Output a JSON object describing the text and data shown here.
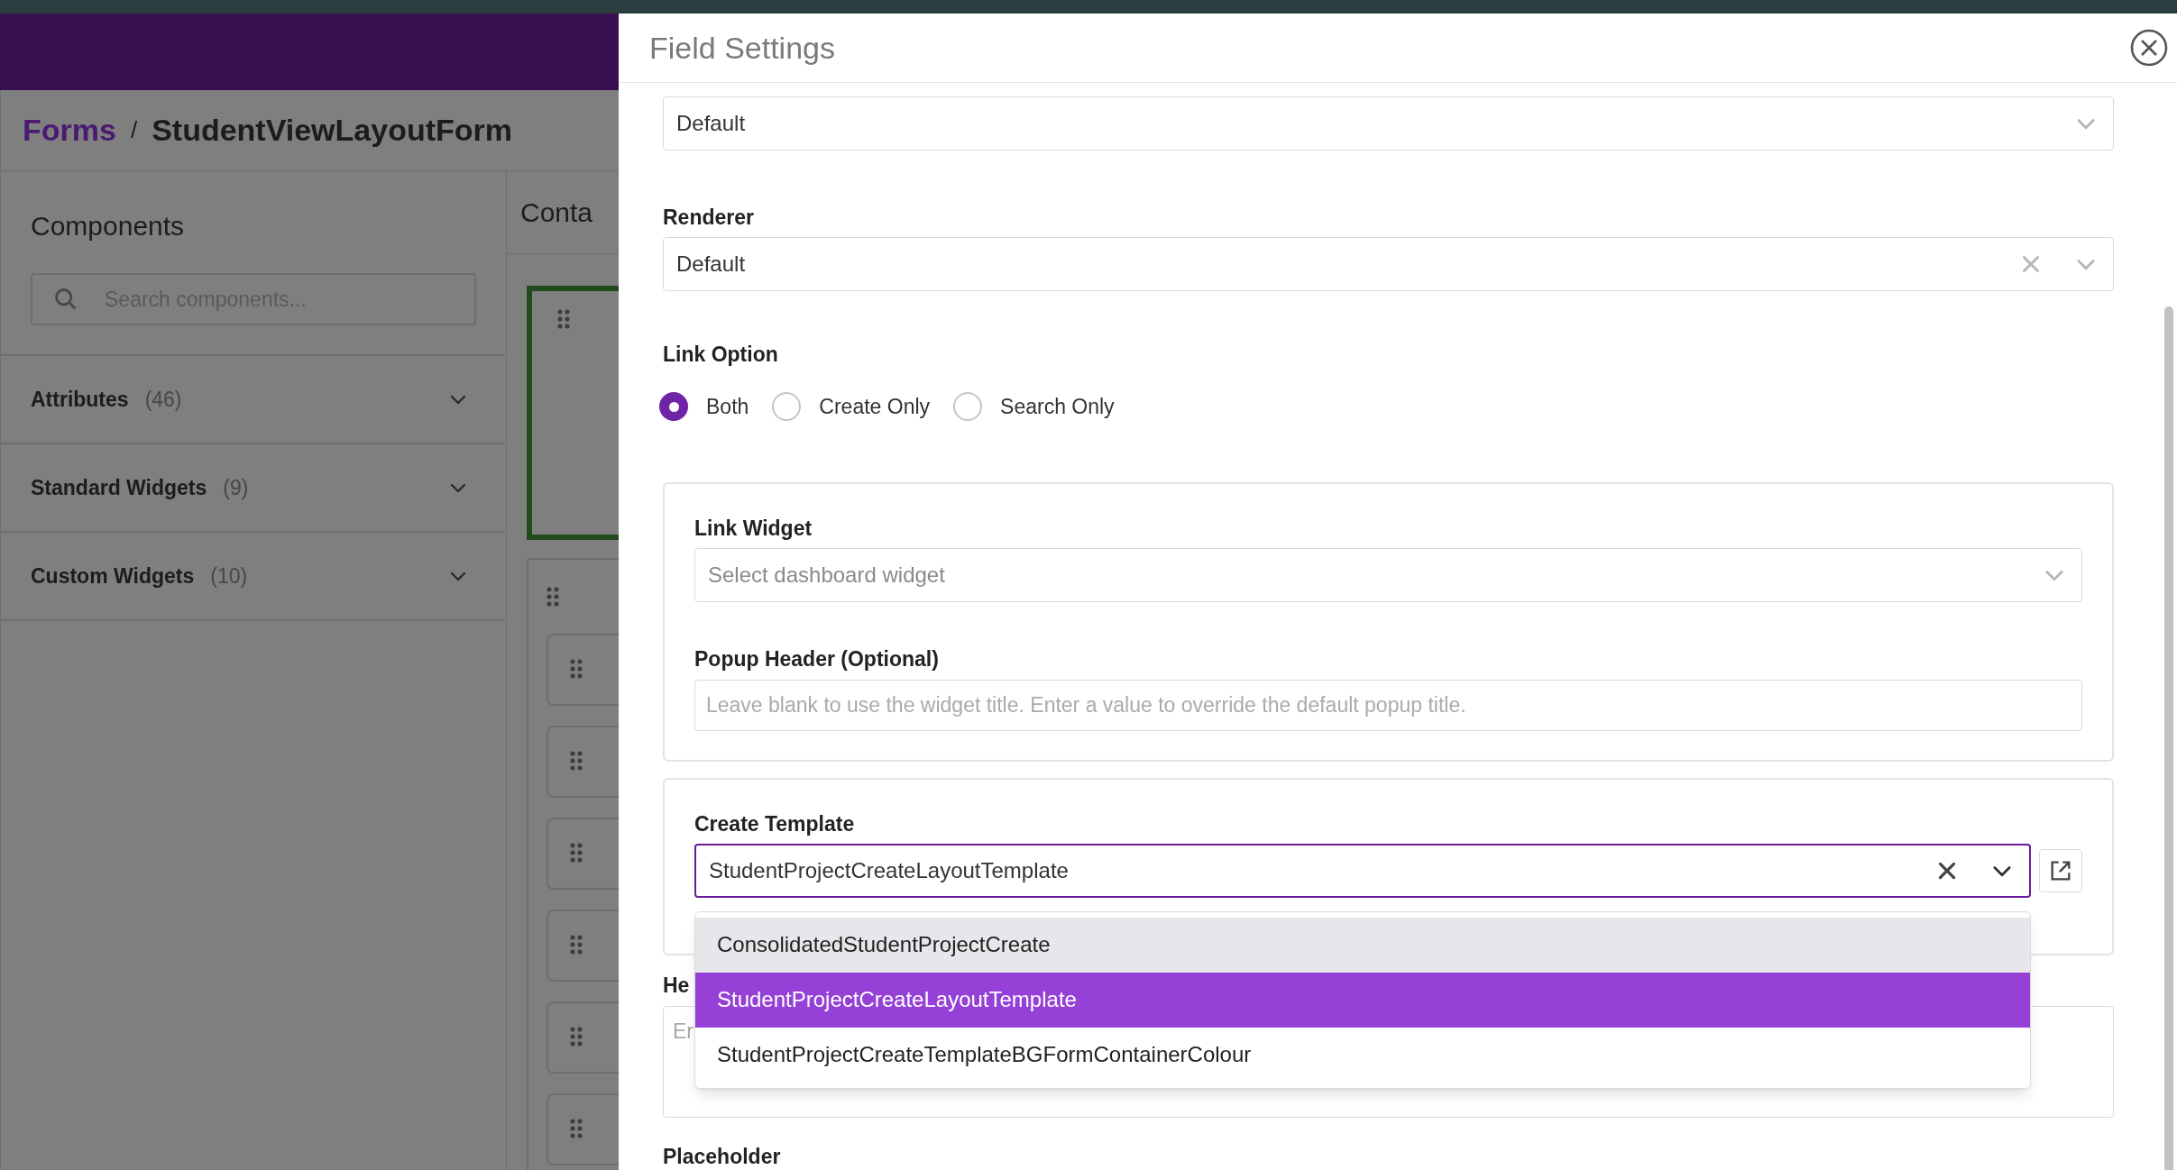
{
  "breadcrumb": {
    "separator": "/",
    "items": [
      {
        "label": "Forms",
        "kind": "link"
      },
      {
        "label": "StudentViewLayoutForm",
        "kind": "current"
      }
    ]
  },
  "sidebar": {
    "title": "Components",
    "search": {
      "placeholder": "Search components..."
    },
    "sections": [
      {
        "label": "Attributes",
        "count": "(46)",
        "expanded": false
      },
      {
        "label": "Standard Widgets",
        "count": "(9)",
        "expanded": false
      },
      {
        "label": "Custom Widgets",
        "count": "(10)",
        "expanded": false
      }
    ]
  },
  "canvas": {
    "title": "Conta"
  },
  "drawer": {
    "title": "Field Settings",
    "editor": {
      "value": "Default"
    },
    "renderer": {
      "label": "Renderer",
      "value": "Default",
      "clearable": true
    },
    "link_option": {
      "label": "Link Option",
      "options": [
        {
          "label": "Both",
          "selected": true
        },
        {
          "label": "Create Only",
          "selected": false
        },
        {
          "label": "Search Only",
          "selected": false
        }
      ]
    },
    "link_widget": {
      "label": "Link Widget",
      "placeholder": "Select dashboard widget"
    },
    "popup_header": {
      "label": "Popup Header (Optional)",
      "placeholder": "Leave blank to use the widget title. Enter a value to override the default popup title."
    },
    "create_template": {
      "label": "Create Template",
      "value": "StudentProjectCreateLayoutTemplate",
      "clearable": true,
      "expanded": true,
      "options": [
        {
          "label": "ConsolidatedStudentProjectCreate",
          "selected": false,
          "hovered": true
        },
        {
          "label": "StudentProjectCreateLayoutTemplate",
          "selected": true,
          "hovered": false
        },
        {
          "label": "StudentProjectCreateTemplateBGFormContainerColour",
          "selected": false,
          "hovered": false
        }
      ]
    },
    "help_text": {
      "label": "He",
      "placeholder": "Er"
    },
    "placeholder_field": {
      "label": "Placeholder"
    }
  }
}
